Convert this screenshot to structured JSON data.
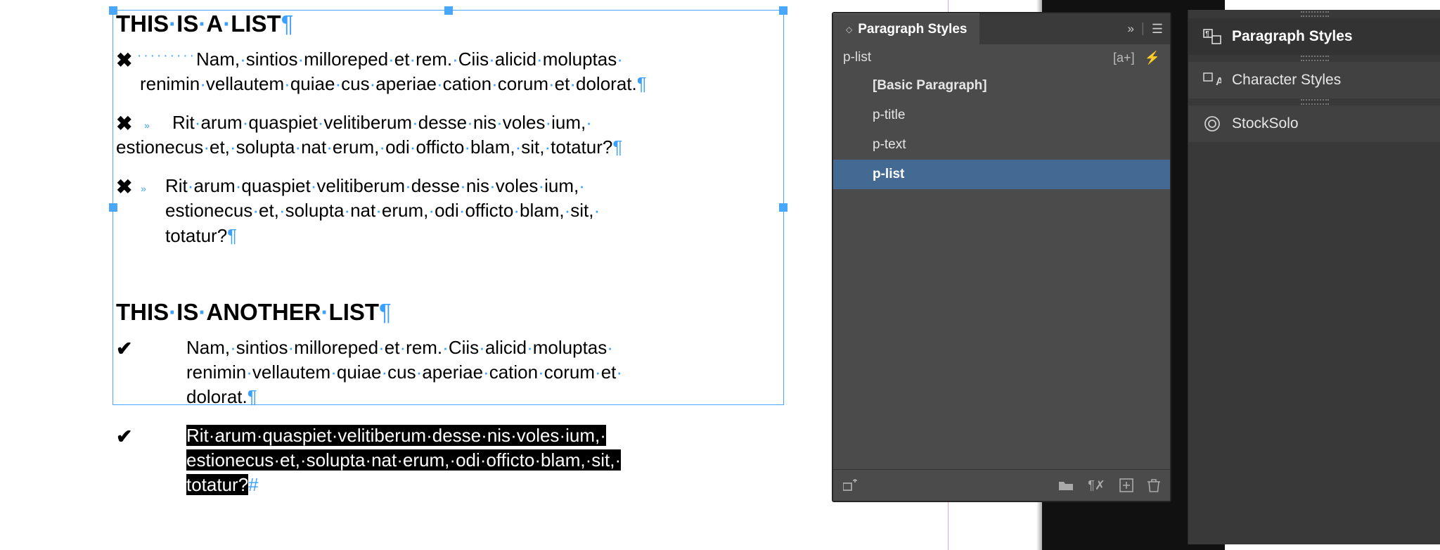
{
  "document": {
    "title1": "THIS IS A LIST",
    "title2": "THIS IS ANOTHER LIST",
    "list1": {
      "item1": "Nam, sintios milloreped et rem. Ciis alicid moluptas renimin vellautem quiae cus aperiae cation corum et dolorat.",
      "item2": "Rit arum quaspiet velitiberum desse nis voles ium, estionecus et, solupta nat erum, odi officto blam, sit, totatur?",
      "item3": "Rit arum quaspiet velitiberum desse nis voles ium, estionecus et, solupta nat erum, odi officto blam, sit, totatur?"
    },
    "list2": {
      "item1": "Nam, sintios milloreped et rem. Ciis alicid moluptas renimin vellautem quiae cus aperiae cation corum et dolorat.",
      "item2_selected": "Rit arum quaspiet velitiberum desse nis voles ium, estionecus et, solupta nat erum, odi officto blam, sit, totatur?"
    }
  },
  "paragraph_styles_panel": {
    "title": "Paragraph Styles",
    "current_style": "p-list",
    "styles": [
      {
        "name": "[Basic Paragraph]",
        "selected": false
      },
      {
        "name": "p-title",
        "selected": false
      },
      {
        "name": "p-text",
        "selected": false
      },
      {
        "name": "p-list",
        "selected": true
      }
    ]
  },
  "dock": {
    "items": [
      {
        "icon": "pilcrow-frame-icon",
        "label": "Paragraph Styles",
        "active": true
      },
      {
        "icon": "character-a-icon",
        "label": "Character Styles",
        "active": false
      },
      {
        "icon": "stocksolo-icon",
        "label": "StockSolo",
        "active": false
      }
    ]
  }
}
